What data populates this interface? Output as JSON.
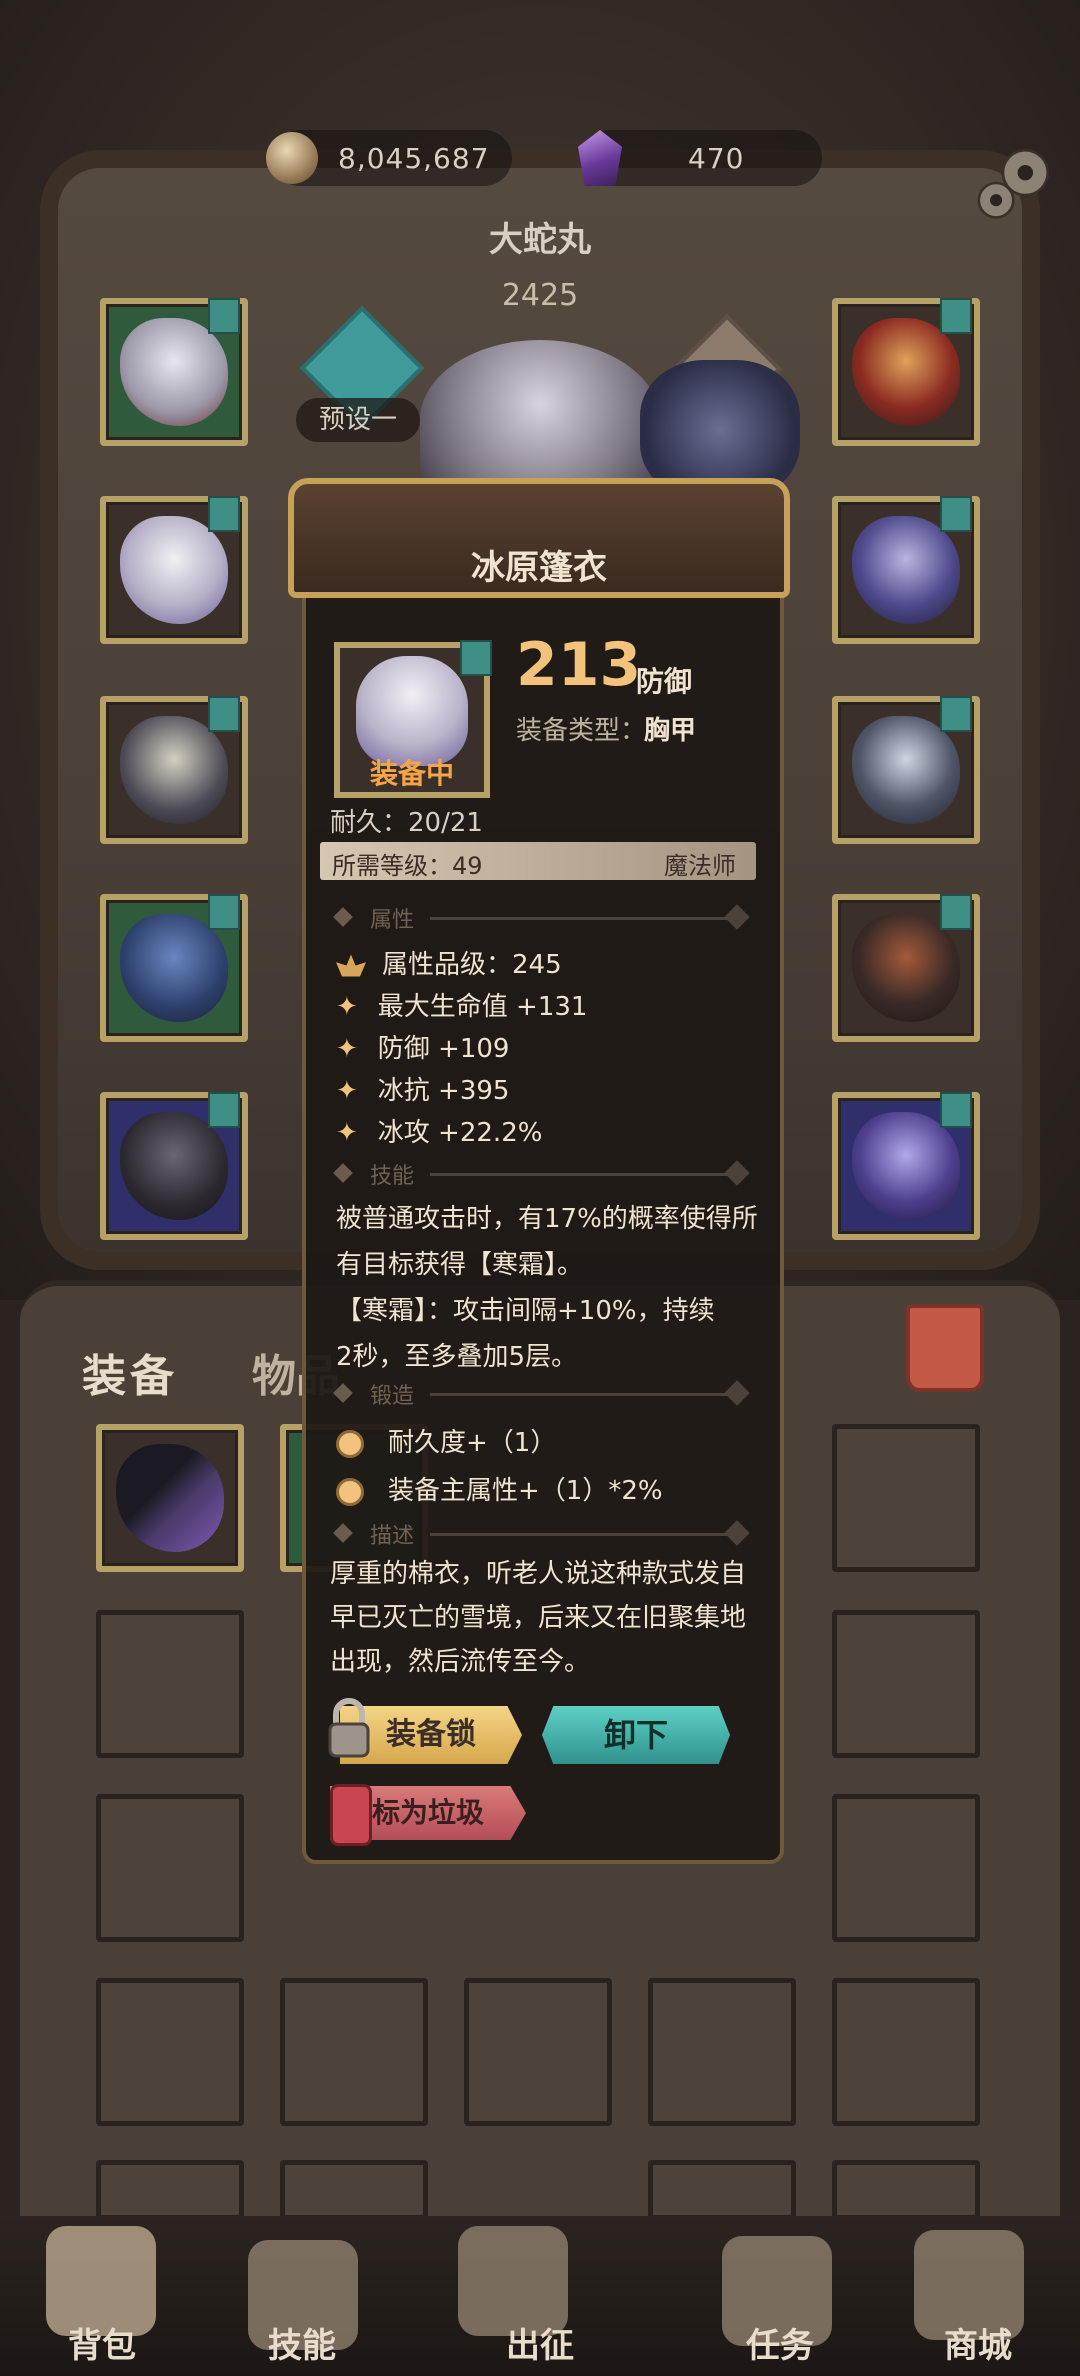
{
  "currency": {
    "gold": "8,045,687",
    "gems": "470"
  },
  "hero": {
    "name": "大蛇丸",
    "power": "2425",
    "preset": "预设一"
  },
  "bag": {
    "tab_equipment": "装备",
    "tab_items": "物品"
  },
  "popup": {
    "title": "冰原篷衣",
    "stat_value": "213",
    "stat_name": "防御",
    "type_label": "装备类型：",
    "type_value": "胸甲",
    "equipped": "装备中",
    "durability": "耐久：20/21",
    "required_level": "所需等级：49",
    "required_class": "魔法师",
    "section_attributes": "属性",
    "attr_grade": "属性品级：245",
    "attrs": [
      "最大生命值 +131",
      "防御 +109",
      "冰抗 +395",
      "冰攻 +22.2%"
    ],
    "section_skill": "技能",
    "skill_line1": "被普通攻击时，有17%的概率使得所",
    "skill_line2": "有目标获得【寒霜】。",
    "skill_line3": "【寒霜】：攻击间隔+10%，持续",
    "skill_line4": "2秒，至多叠加5层。",
    "section_forge": "锻造",
    "forge": [
      "耐久度+（1）",
      "装备主属性+（1）*2%"
    ],
    "section_desc": "描述",
    "desc_line1": "厚重的棉衣，听老人说这种款式发自",
    "desc_line2": "早已灭亡的雪境，后来又在旧聚集地",
    "desc_line3": "出现，然后流传至今。",
    "btn_lock": "装备锁",
    "btn_unequip": "卸下",
    "btn_trash": "标为垃圾"
  },
  "nav": [
    "背包",
    "技能",
    "出征",
    "任务",
    "商城"
  ],
  "colors": {
    "accent_gold": "#f3c27d",
    "teal": "#3f9c9a",
    "equipped_orange": "#f5a548"
  }
}
